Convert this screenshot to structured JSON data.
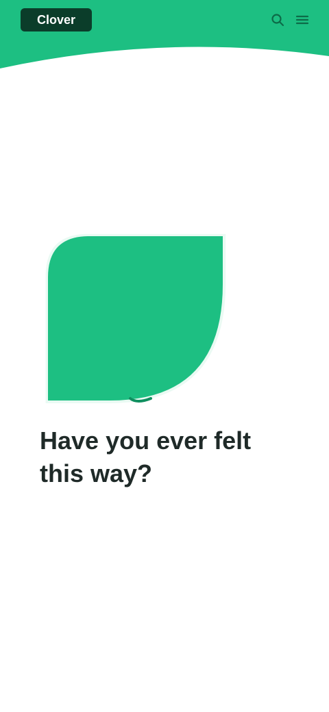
{
  "app": {
    "brand_label": "Clover"
  },
  "header": {
    "actions": [
      {
        "icon": "search-icon"
      },
      {
        "icon": "menu-icon"
      }
    ]
  },
  "hero": {
    "icon": "leaf-icon"
  },
  "main": {
    "question": "Have you ever felt this way?"
  },
  "colors": {
    "brand_green": "#1dbf82",
    "brand_dark": "#0b3d2a",
    "text_dark": "#1f2a28",
    "background": "#ffffff"
  }
}
